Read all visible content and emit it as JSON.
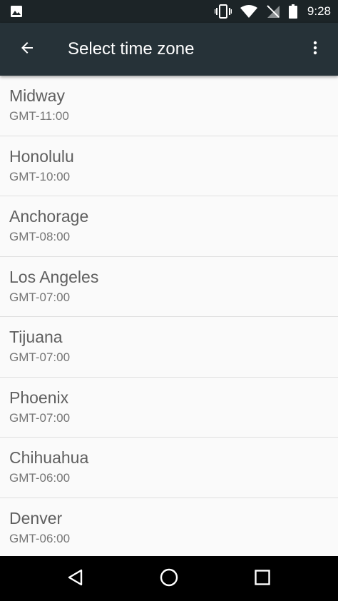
{
  "status_bar": {
    "time": "9:28",
    "icons": [
      "image-icon",
      "vibrate-icon",
      "wifi-icon",
      "no-signal-icon",
      "battery-icon"
    ]
  },
  "toolbar": {
    "title": "Select time zone",
    "back_icon": "arrow-back-icon",
    "overflow_icon": "more-vert-icon"
  },
  "time_zones": [
    {
      "name": "Midway",
      "offset": "GMT-11:00"
    },
    {
      "name": "Honolulu",
      "offset": "GMT-10:00"
    },
    {
      "name": "Anchorage",
      "offset": "GMT-08:00"
    },
    {
      "name": "Los Angeles",
      "offset": "GMT-07:00"
    },
    {
      "name": "Tijuana",
      "offset": "GMT-07:00"
    },
    {
      "name": "Phoenix",
      "offset": "GMT-07:00"
    },
    {
      "name": "Chihuahua",
      "offset": "GMT-06:00"
    },
    {
      "name": "Denver",
      "offset": "GMT-06:00"
    }
  ],
  "nav_bar": {
    "icons": [
      "back-triangle-icon",
      "home-circle-icon",
      "recents-square-icon"
    ]
  },
  "colors": {
    "toolbar": "#263238",
    "status_bar": "#1c2427",
    "background": "#fafafa",
    "nav_bar": "#000000"
  }
}
